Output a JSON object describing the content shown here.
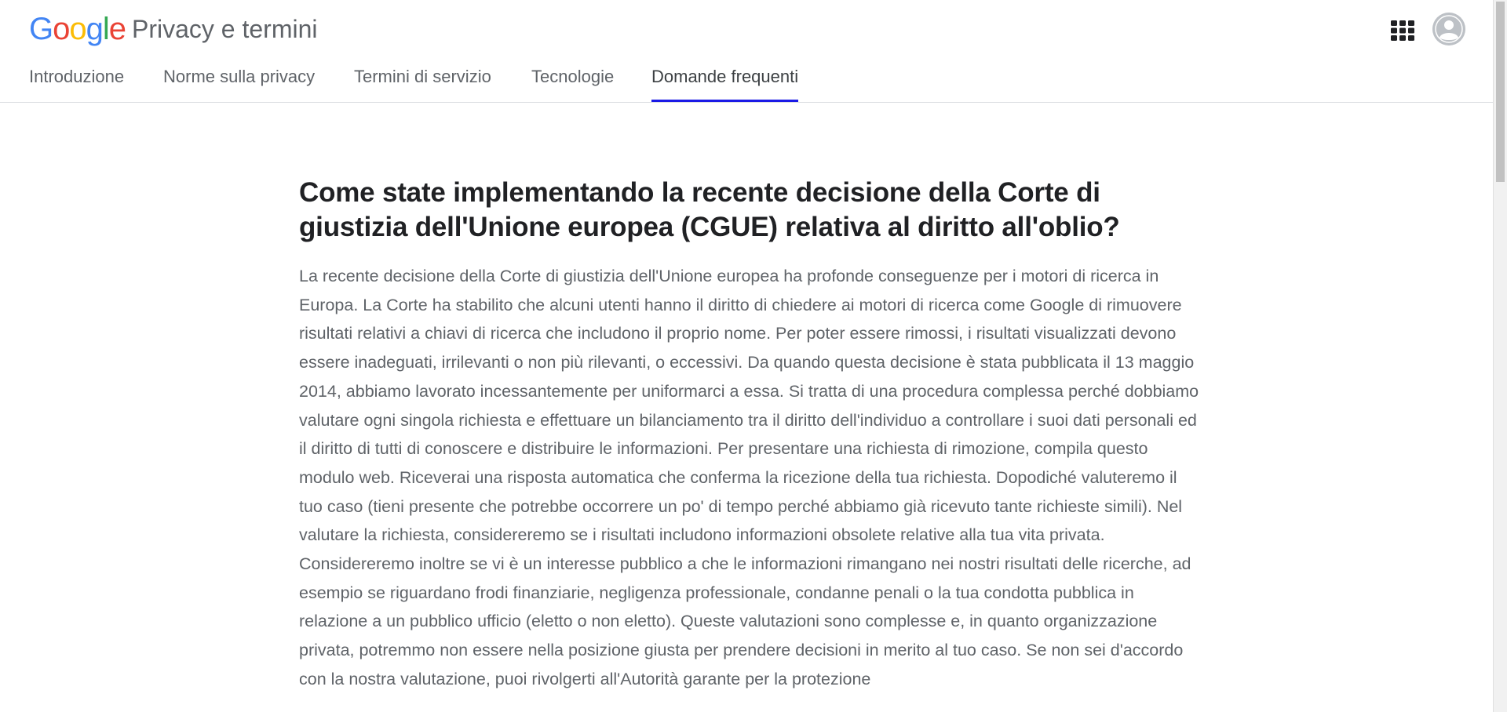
{
  "header": {
    "logo_text": "Google",
    "product_name": "Privacy e termini",
    "apps_icon": "apps-grid-icon",
    "avatar_icon": "account-avatar-icon"
  },
  "nav": {
    "tabs": [
      {
        "label": "Introduzione",
        "active": false
      },
      {
        "label": "Norme sulla privacy",
        "active": false
      },
      {
        "label": "Termini di servizio",
        "active": false
      },
      {
        "label": "Tecnologie",
        "active": false
      },
      {
        "label": "Domande frequenti",
        "active": true
      }
    ],
    "active_underline_color": "#1a1ae6"
  },
  "faq": {
    "question": "Come state implementando la recente decisione della Corte di giustizia dell'Unione europea (CGUE) relativa al diritto all'oblio?",
    "answer": "La recente decisione della Corte di giustizia dell'Unione europea ha profonde conseguenze per i motori di ricerca in Europa. La Corte ha stabilito che alcuni utenti hanno il diritto di chiedere ai motori di ricerca come Google di rimuovere risultati relativi a chiavi di ricerca che includono il proprio nome. Per poter essere rimossi, i risultati visualizzati devono essere inadeguati, irrilevanti o non più rilevanti, o eccessivi. Da quando questa decisione è stata pubblicata il 13 maggio 2014, abbiamo lavorato incessantemente per uniformarci a essa. Si tratta di una procedura complessa perché dobbiamo valutare ogni singola richiesta e effettuare un bilanciamento tra il diritto dell'individuo a controllare i suoi dati personali ed il diritto di tutti di conoscere e distribuire le informazioni. Per presentare una richiesta di rimozione, compila questo modulo web. Riceverai una risposta automatica che conferma la ricezione della tua richiesta. Dopodiché valuteremo il tuo caso (tieni presente che potrebbe occorrere un po' di tempo perché abbiamo già ricevuto tante richieste simili). Nel valutare la richiesta, considereremo se i risultati includono informazioni obsolete relative alla tua vita privata. Considereremo inoltre se vi è un interesse pubblico a che le informazioni rimangano nei nostri risultati delle ricerche, ad esempio se riguardano frodi finanziarie, negligenza professionale, condanne penali o la tua condotta pubblica in relazione a un pubblico ufficio (eletto o non eletto). Queste valutazioni sono complesse e, in quanto organizzazione privata, potremmo non essere nella posizione giusta per prendere decisioni in merito al tuo caso. Se non sei d'accordo con la nostra valutazione, puoi rivolgerti all'Autorità garante per la protezione"
  }
}
